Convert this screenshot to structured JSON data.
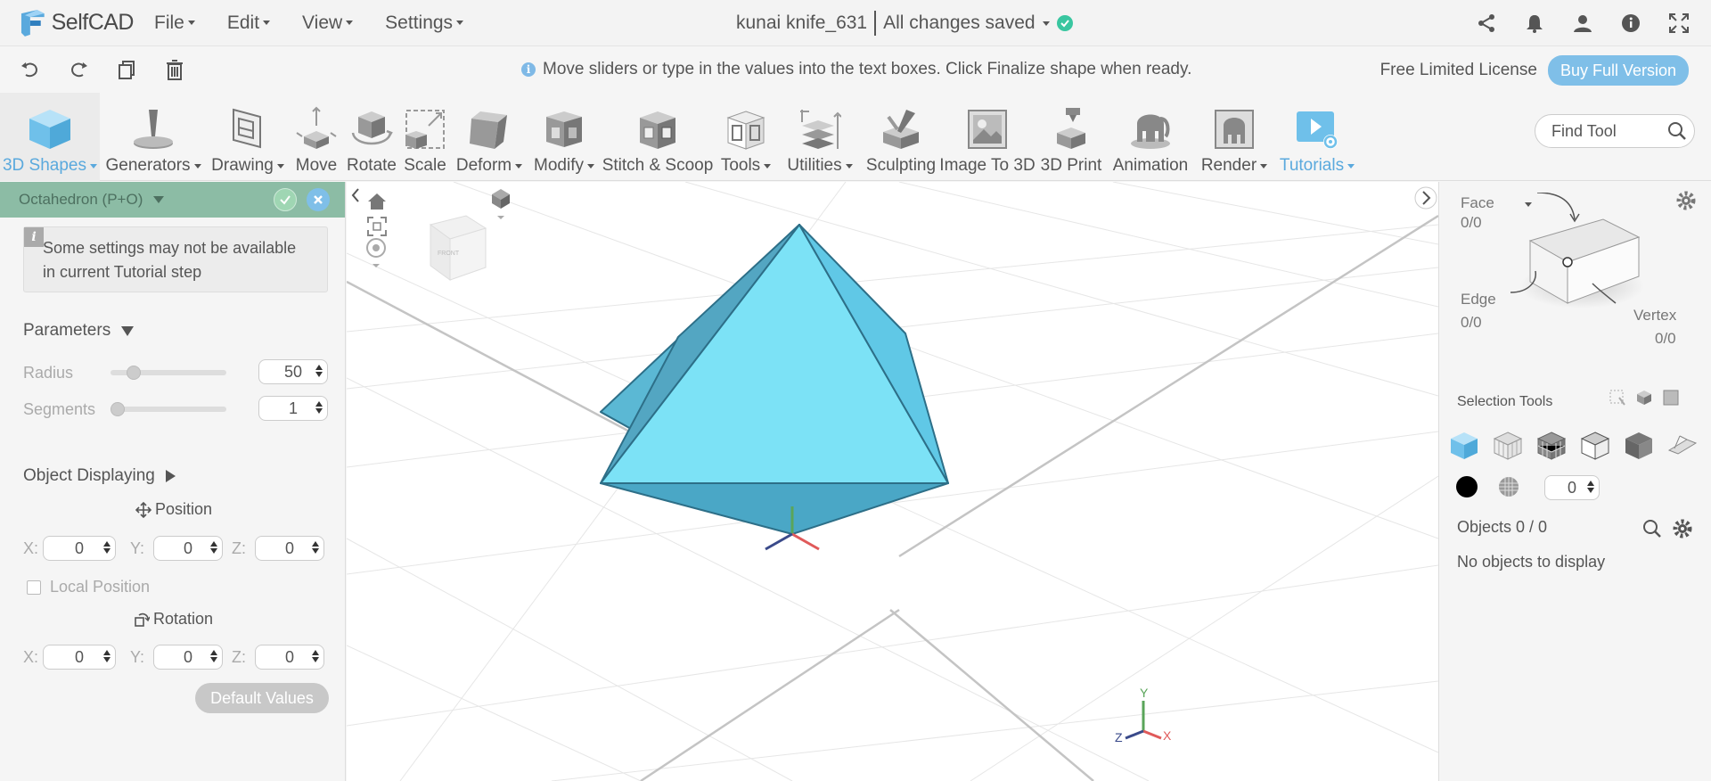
{
  "app": {
    "logo_text": "SelfCAD",
    "menus": [
      "File",
      "Edit",
      "View",
      "Settings"
    ],
    "file_name": "kunai knife_631",
    "save_status": "All changes saved"
  },
  "hint_bar": {
    "message": "Move sliders or type in the values into the text boxes. Click Finalize shape when ready.",
    "license_text": "Free Limited License",
    "buy_label": "Buy Full Version"
  },
  "toolbar": {
    "tools": [
      {
        "label": "3D Shapes",
        "dropdown": true,
        "active": true,
        "blue": true
      },
      {
        "label": "Generators",
        "dropdown": true
      },
      {
        "label": "Drawing",
        "dropdown": true
      },
      {
        "label": "Move"
      },
      {
        "label": "Rotate"
      },
      {
        "label": "Scale"
      },
      {
        "label": "Deform",
        "dropdown": true
      },
      {
        "label": "Modify",
        "dropdown": true
      },
      {
        "label": "Stitch & Scoop"
      },
      {
        "label": "Tools",
        "dropdown": true
      },
      {
        "label": "Utilities",
        "dropdown": true
      },
      {
        "label": "Sculpting"
      },
      {
        "label": "Image To 3D"
      },
      {
        "label": "3D Print"
      },
      {
        "label": "Animation"
      },
      {
        "label": "Render",
        "dropdown": true
      },
      {
        "label": "Tutorials",
        "dropdown": true,
        "blue": true
      }
    ],
    "find_tool_placeholder": "Find Tool"
  },
  "left_panel": {
    "header_title": "Octahedron (P+O)",
    "notice": "Some settings may not be available in current Tutorial step",
    "parameters_title": "Parameters",
    "radius_label": "Radius",
    "radius_value": "50",
    "radius_fraction": 0.16,
    "segments_label": "Segments",
    "segments_value": "1",
    "segments_fraction": 0.0,
    "object_displaying_title": "Object Displaying",
    "position_label": "Position",
    "position": {
      "x": "0",
      "y": "0",
      "z": "0"
    },
    "local_position_label": "Local Position",
    "rotation_label": "Rotation",
    "rotation": {
      "x": "0",
      "y": "0",
      "z": "0"
    },
    "axis_labels": {
      "x": "X:",
      "y": "Y:",
      "z": "Z:"
    },
    "default_values_label": "Default Values"
  },
  "viewport": {
    "axis_labels": {
      "x": "X",
      "y": "Y",
      "z": "Z"
    },
    "shape_color": "#6ed3ea",
    "navcube_front": "FRONT"
  },
  "right_panel": {
    "face_label": "Face",
    "face_count": "0/0",
    "edge_label": "Edge",
    "edge_count": "0/0",
    "vertex_label": "Vertex",
    "vertex_count": "0/0",
    "selection_tools_title": "Selection Tools",
    "opacity_value": "0",
    "objects_label": "Objects 0 / 0",
    "no_objects": "No objects to display"
  },
  "colors": {
    "accent": "#7fbfe8",
    "panel_header": "#8cbca5",
    "saved": "#39c6a0"
  }
}
